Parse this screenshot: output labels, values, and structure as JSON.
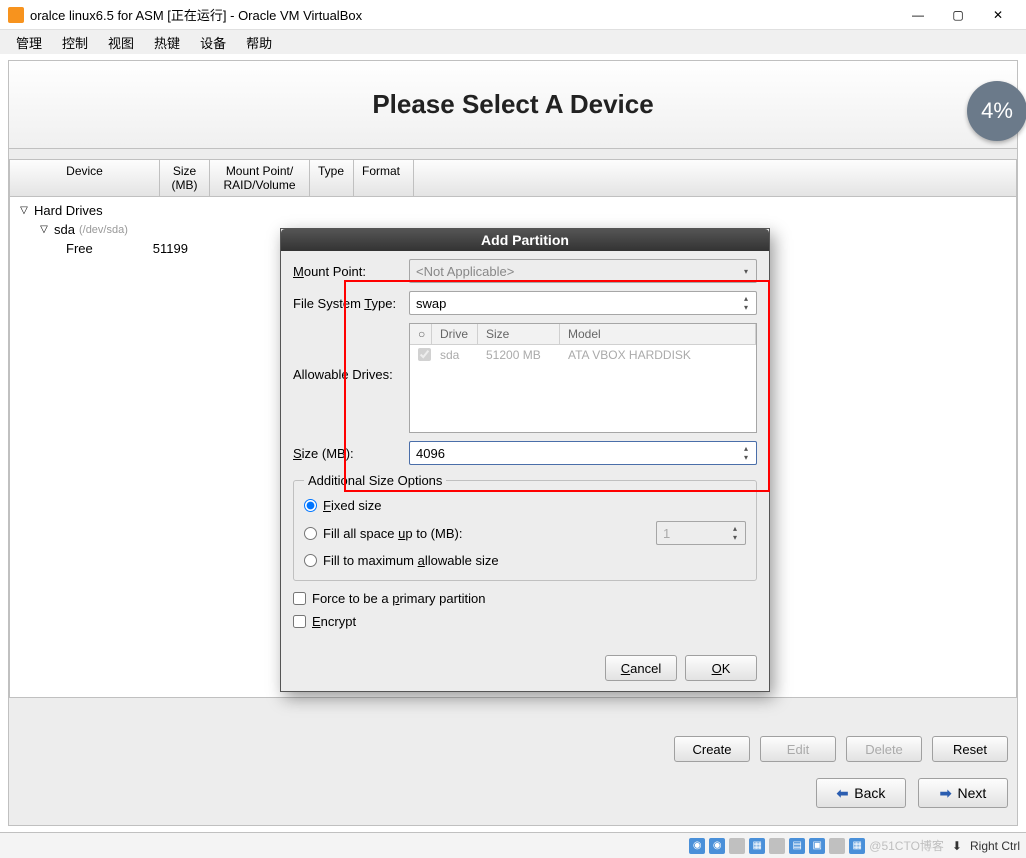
{
  "window": {
    "title": "oralce linux6.5 for ASM [正在运行] - Oracle VM VirtualBox",
    "min": "—",
    "max": "▢",
    "close": "✕"
  },
  "menu": [
    "管理",
    "控制",
    "视图",
    "热键",
    "设备",
    "帮助"
  ],
  "banner": {
    "title": "Please Select A Device",
    "badge": "4%"
  },
  "table": {
    "cols": {
      "device": "Device",
      "size": "Size\n(MB)",
      "mount": "Mount Point/\nRAID/Volume",
      "type": "Type",
      "format": "Format"
    },
    "root": "Hard Drives",
    "disk": {
      "name": "sda",
      "hint": "(/dev/sda)"
    },
    "free": {
      "label": "Free",
      "size": "51199"
    }
  },
  "dialog": {
    "title": "Add Partition",
    "mount_label": "Mount Point:",
    "mount_value": "<Not Applicable>",
    "fstype_label": "File System Type:",
    "fstype_value": "swap",
    "drives_label": "Allowable Drives:",
    "drives_head": {
      "chk": "○",
      "drive": "Drive",
      "size": "Size",
      "model": "Model"
    },
    "drive_row": {
      "name": "sda",
      "size": "51200 MB",
      "model": "ATA VBOX HARDDISK"
    },
    "size_label": "Size (MB):",
    "size_value": "4096",
    "addl_legend": "Additional Size Options",
    "opt_fixed": "Fixed size",
    "opt_fillto": "Fill all space up to (MB):",
    "opt_fillto_value": "1",
    "opt_fillmax": "Fill to maximum allowable size",
    "force_primary": "Force to be a primary partition",
    "encrypt": "Encrypt",
    "cancel": "Cancel",
    "ok": "OK"
  },
  "actions": {
    "create": "Create",
    "edit": "Edit",
    "delete": "Delete",
    "reset": "Reset"
  },
  "nav": {
    "back": "Back",
    "next": "Next"
  },
  "statusbar": {
    "watermark": "@51CTO博客",
    "host_key": "Right Ctrl"
  }
}
